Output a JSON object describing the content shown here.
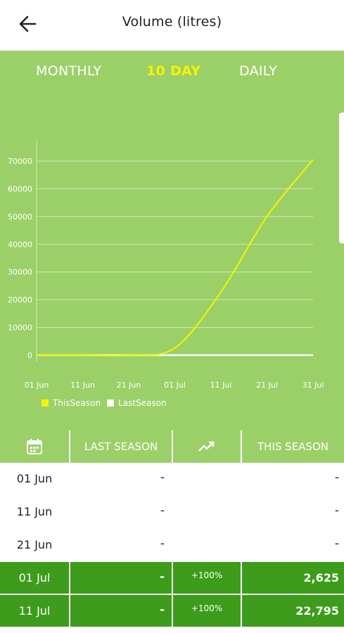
{
  "header": {
    "title": "Volume (litres)",
    "back_icon": "arrow-left-icon"
  },
  "tabs": [
    {
      "label": "MONTHLY",
      "active": false
    },
    {
      "label": "10 DAY",
      "active": true
    },
    {
      "label": "DAILY",
      "active": false
    }
  ],
  "colors": {
    "panel_bg": "#9bd068",
    "active_tab": "#f5f500",
    "this_season": "#f5f500",
    "last_season": "#ffffff",
    "highlight_row": "#3d9c1b"
  },
  "chart_data": {
    "type": "line",
    "x": [
      "01 Jun",
      "11 Jun",
      "21 Jun",
      "01 Jul",
      "11 Jul",
      "21 Jul",
      "31 Jul"
    ],
    "series": [
      {
        "name": "ThisSeason",
        "color": "#f5f500",
        "values": [
          0,
          0,
          0,
          2625,
          22795,
          50000,
          70500
        ]
      },
      {
        "name": "LastSeason",
        "color": "#ffffff",
        "values": [
          0,
          0,
          0,
          0,
          0,
          0,
          0
        ]
      }
    ],
    "yticks": [
      "0",
      "10000",
      "20000",
      "30000",
      "40000",
      "50000",
      "60000",
      "70000"
    ],
    "ylim": [
      0,
      70000
    ],
    "grid": true,
    "legend_position": "bottom-left"
  },
  "table": {
    "columns": {
      "date_icon": "calendar-icon",
      "last_season": "LAST SEASON",
      "trend_icon": "trending-up-icon",
      "this_season": "THIS SEASON"
    },
    "rows": [
      {
        "date": "01 Jun",
        "last": "-",
        "change": "",
        "this": "-",
        "highlight": false
      },
      {
        "date": "11 Jun",
        "last": "-",
        "change": "",
        "this": "-",
        "highlight": false
      },
      {
        "date": "21 Jun",
        "last": "-",
        "change": "",
        "this": "-",
        "highlight": false
      },
      {
        "date": "01 Jul",
        "last": "-",
        "change": "+100%",
        "this": "2,625",
        "highlight": true
      },
      {
        "date": "11 Jul",
        "last": "-",
        "change": "+100%",
        "this": "22,795",
        "highlight": true
      }
    ]
  }
}
